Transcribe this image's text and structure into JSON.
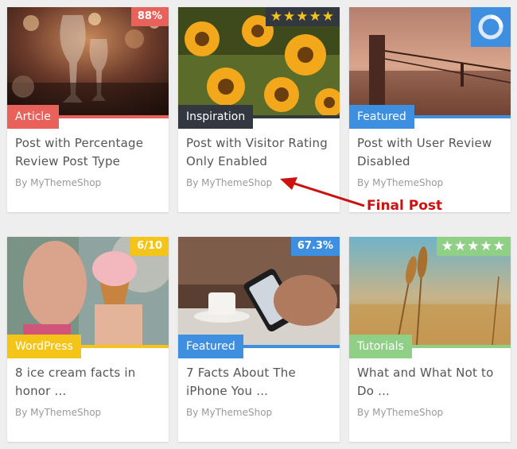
{
  "colors": {
    "red": "#e8625b",
    "dark": "#333840",
    "blue": "#3f8fe0",
    "yellow": "#f5c419",
    "green": "#8fcf86",
    "annotation": "#cc1111"
  },
  "posts": [
    {
      "category": "Article",
      "title": "Post with Percentage Review Post Type",
      "author": "By MyThemeShop",
      "rating": {
        "type": "percentage",
        "text": "88%"
      }
    },
    {
      "category": "Inspiration",
      "title": "Post with Visitor Rating Only Enabled",
      "author": "By MyThemeShop",
      "rating": {
        "type": "stars",
        "stars": 5
      }
    },
    {
      "category": "Featured",
      "title": "Post with User Review Disabled",
      "author": "By MyThemeShop",
      "rating": {
        "type": "loading",
        "icon": "loading-ring-icon"
      }
    },
    {
      "category": "WordPress",
      "title": "8 ice cream facts in honor ...",
      "author": "By MyThemeShop",
      "rating": {
        "type": "score",
        "text": "6/10"
      }
    },
    {
      "category": "Featured",
      "title": "7 Facts About The iPhone You ...",
      "author": "By MyThemeShop",
      "rating": {
        "type": "percentage",
        "text": "67.3%"
      }
    },
    {
      "category": "Tutorials",
      "title": "What and What Not to Do ...",
      "author": "By MyThemeShop",
      "rating": {
        "type": "stars",
        "stars": 5
      }
    }
  ],
  "annotation": {
    "label": "Final Post",
    "icon": "arrow-icon"
  }
}
